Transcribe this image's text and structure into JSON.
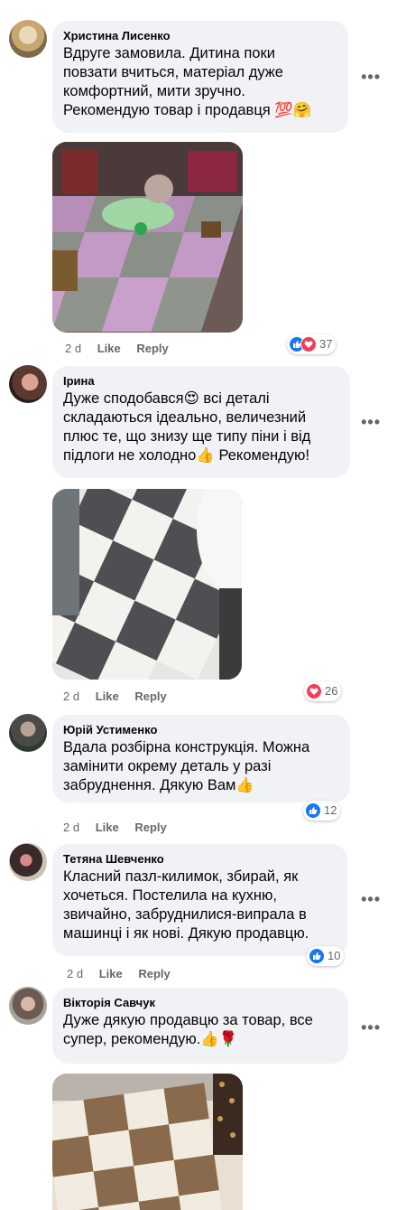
{
  "comments": [
    {
      "author": "Христина Лисенко",
      "text": "Вдруге замовила. Дитина поки\nповзати вчиться, матеріал дуже\nкомфортний, мити зручно.\nРекомендую товар і продавця 💯🤗",
      "time": "2 d",
      "like": "Like",
      "reply": "Reply",
      "reactions": [
        "like-icon",
        "love-icon"
      ],
      "count": "37"
    },
    {
      "author": "Ірина",
      "text": "Дуже сподобався😍 всі деталі\nскладаються ідеально, величезний\nплюс те, що знизу ще типу піни і від\nпідлоги не холодно👍 Рекомендую!",
      "time": "2 d",
      "like": "Like",
      "reply": "Reply",
      "reactions": [
        "love-icon"
      ],
      "count": "26"
    },
    {
      "author": "Юрій Устименко",
      "text": "Вдала розбірна конструкція. Можна\nзамінити окрему деталь у разі\nзабруднення. Дякую Вам👍",
      "time": "2 d",
      "like": "Like",
      "reply": "Reply",
      "reactions": [
        "like-icon"
      ],
      "count": "12"
    },
    {
      "author": "Тетяна Шевченко",
      "text": "Класний пазл-килимок, збирай, як\nхочеться. Постелила на кухню,\nзвичайно, забруднилися-випрала в\nмашинці і як нові. Дякую продавцю.",
      "time": "2 d",
      "like": "Like",
      "reply": "Reply",
      "reactions": [
        "like-icon"
      ],
      "count": "10"
    },
    {
      "author": "Вікторія Савчук",
      "text": "Дуже дякую продавцю за товар, все\nсупер, рекомендую.👍🌹"
    }
  ],
  "colors": {
    "bubble": "#f0f2f5",
    "like_blue": "#1877f2",
    "love_red": "#f33e58",
    "meta_grey": "#65676b"
  }
}
